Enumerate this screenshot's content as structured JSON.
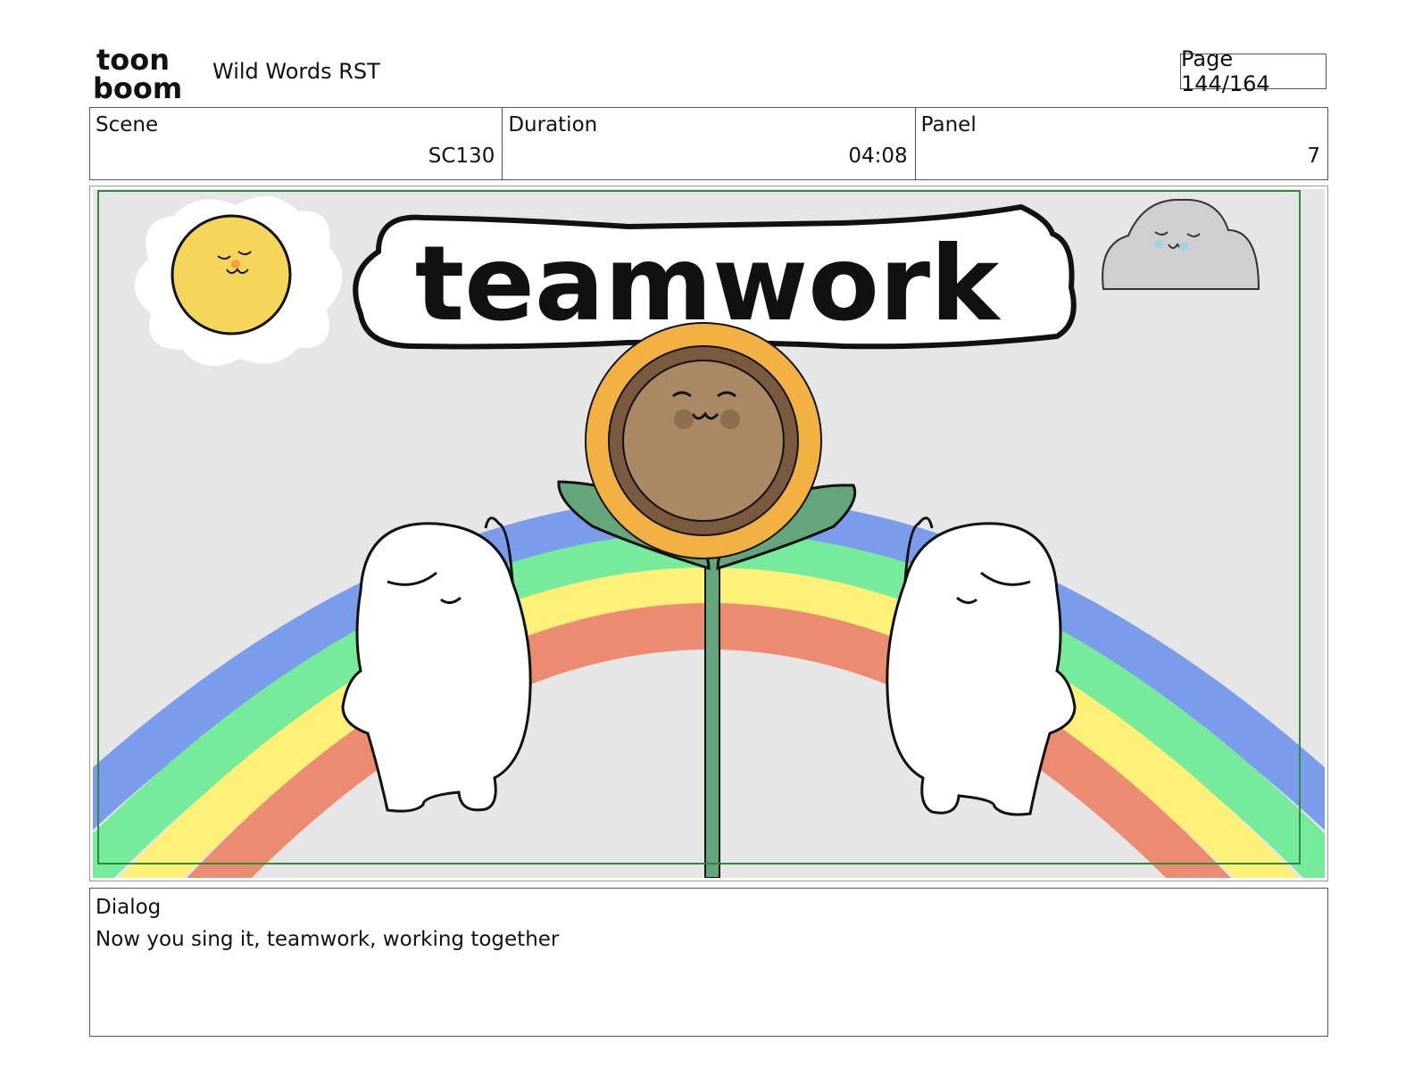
{
  "header": {
    "logo_line1": "toon",
    "logo_line2": "boom",
    "project_title": "Wild Words RST",
    "page_label": "Page 144/164"
  },
  "info": {
    "scene_label": "Scene",
    "scene_value": "SC130",
    "duration_label": "Duration",
    "duration_value": "04:08",
    "panel_label": "Panel",
    "panel_value": "7"
  },
  "panel": {
    "title_word": "teamwork",
    "colors": {
      "background": "#e6e6e6",
      "safe_frame": "#2e8b3a",
      "rainbow_blue": "#7b9ceb",
      "rainbow_green": "#76eb9b",
      "rainbow_yellow": "#fff07a",
      "rainbow_red": "#ea8b72",
      "sun": "#f6d65a",
      "cloud": "#cfcfcf",
      "petals": "#f3b143",
      "seed_head": "#a88963",
      "leaves": "#64a57b"
    }
  },
  "dialog": {
    "label": "Dialog",
    "text": "Now you sing it, teamwork, working together"
  }
}
